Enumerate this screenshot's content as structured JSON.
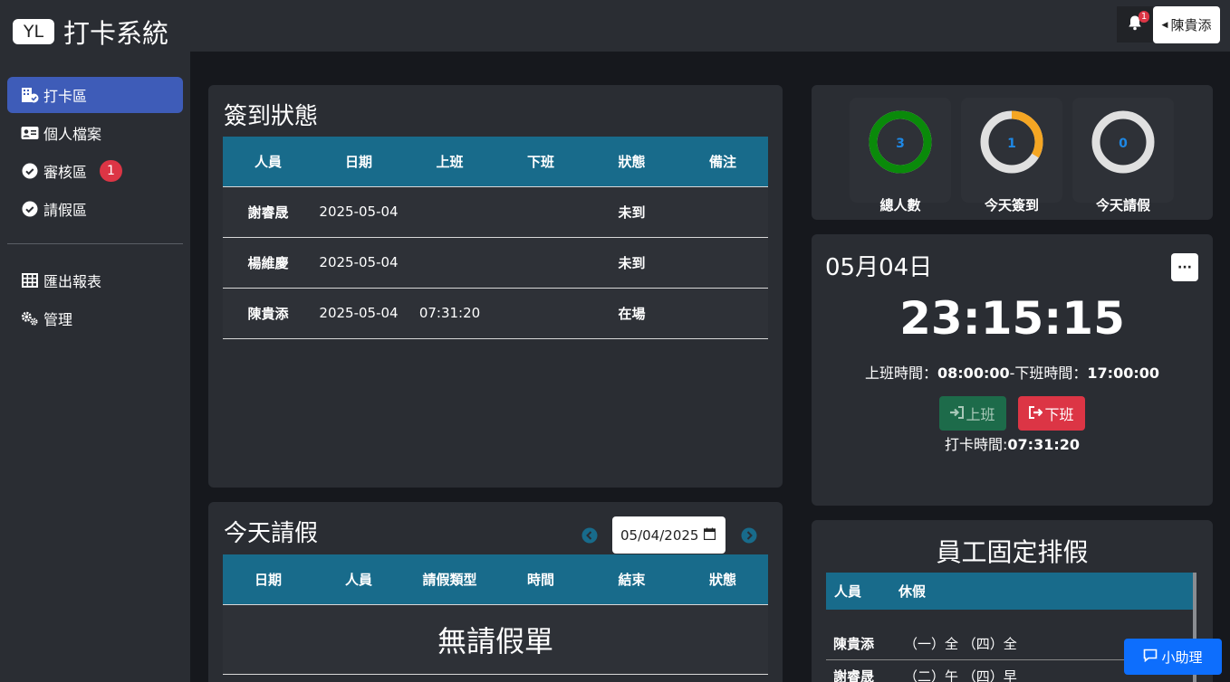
{
  "brand": {
    "badge": "YL",
    "title": "打卡系統"
  },
  "sidebar": {
    "items": [
      {
        "label": "打卡區",
        "icon": "building-check-icon",
        "active": true
      },
      {
        "label": "個人檔案",
        "icon": "id-card-icon"
      },
      {
        "label": "審核區",
        "icon": "check-circle-icon",
        "badge": "1"
      },
      {
        "label": "請假區",
        "icon": "check-circle-icon"
      },
      {
        "label": "匯出報表",
        "icon": "table-icon"
      },
      {
        "label": "管理",
        "icon": "gears-icon"
      }
    ]
  },
  "topbar": {
    "notification_count": "1",
    "user_name": "陳貴添"
  },
  "checkin": {
    "title": "簽到狀態",
    "columns": [
      "人員",
      "日期",
      "上班",
      "下班",
      "狀態",
      "備注"
    ],
    "rows": [
      {
        "name": "謝睿晟",
        "date": "2025-05-04",
        "in": "",
        "out": "",
        "status": "未到",
        "note": ""
      },
      {
        "name": "楊維慶",
        "date": "2025-05-04",
        "in": "",
        "out": "",
        "status": "未到",
        "note": ""
      },
      {
        "name": "陳貴添",
        "date": "2025-05-04",
        "in": "07:31:20",
        "out": "",
        "status": "在場",
        "note": ""
      }
    ]
  },
  "leave": {
    "title": "今天請假",
    "date_value": "05/04/2025",
    "columns": [
      "日期",
      "人員",
      "請假類型",
      "時間",
      "結束",
      "狀態"
    ],
    "empty": "無請假單"
  },
  "stats": [
    {
      "value": "3",
      "label": "總人數",
      "fraction": 1.0,
      "color": "#0a8a0a"
    },
    {
      "value": "1",
      "label": "今天簽到",
      "fraction": 0.3333,
      "color": "#f5a623"
    },
    {
      "value": "0",
      "label": "今天請假",
      "fraction": 0,
      "color": "#0a8a0a"
    }
  ],
  "clock": {
    "date": "05月04日",
    "time": "23:15:15",
    "work_start_label": "上班時間：",
    "work_start": "08:00:00",
    "sep": "-",
    "work_end_label": "下班時間：",
    "work_end": "17:00:00",
    "btn_in": "上班",
    "btn_out": "下班",
    "punch_label": "打卡時間:",
    "punch_time": "07:31:20",
    "more": "···"
  },
  "fixed_leave": {
    "title": "員工固定排假",
    "columns": [
      "人員",
      "休假"
    ],
    "rows": [
      {
        "name": "陳貴添",
        "days": "（一）全 （四）全"
      },
      {
        "name": "謝睿晟",
        "days": "（二）午 （四）早"
      }
    ]
  },
  "assistant": {
    "label": "小助理"
  }
}
